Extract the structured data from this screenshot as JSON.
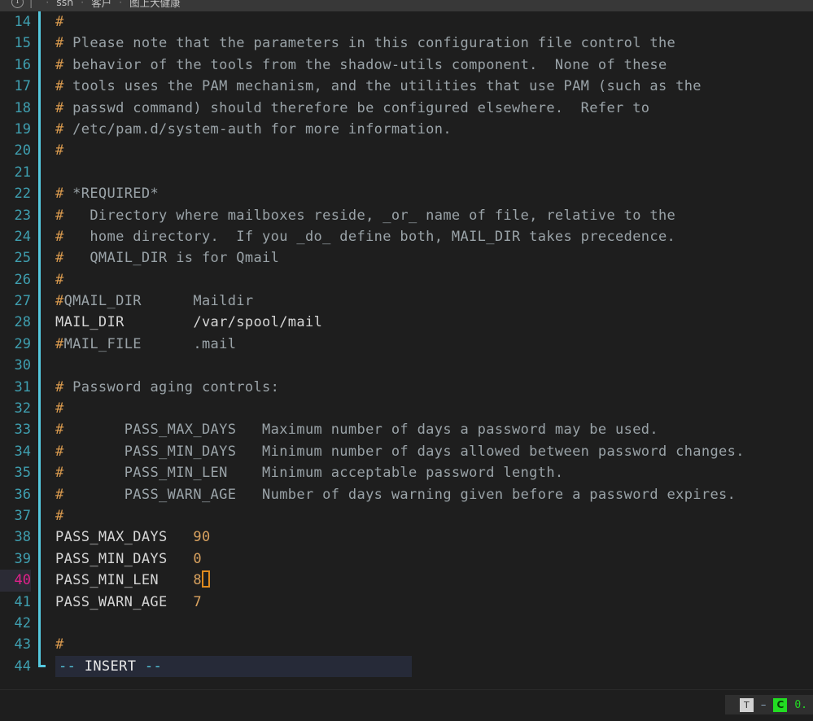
{
  "topbar": {
    "icon": "info-circle-icon",
    "icon_glyph": "i",
    "divider": "|",
    "crumbs": [
      "ssh",
      "客户",
      "图上大健康"
    ],
    "separator": "·"
  },
  "editor": {
    "mode_line": "-- INSERT --",
    "cursor_line": 40,
    "cursor_col_text": "8",
    "lines": [
      {
        "n": 14,
        "guide": "bar",
        "text": "#"
      },
      {
        "n": 15,
        "guide": "bar",
        "text": "# Please note that the parameters in this configuration file control the"
      },
      {
        "n": 16,
        "guide": "bar",
        "text": "# behavior of the tools from the shadow-utils component.  None of these"
      },
      {
        "n": 17,
        "guide": "bar",
        "text": "# tools uses the PAM mechanism, and the utilities that use PAM (such as the"
      },
      {
        "n": 18,
        "guide": "bar",
        "text": "# passwd command) should therefore be configured elsewhere.  Refer to"
      },
      {
        "n": 19,
        "guide": "bar",
        "text": "# /etc/pam.d/system-auth for more information."
      },
      {
        "n": 20,
        "guide": "bar",
        "text": "#"
      },
      {
        "n": 21,
        "guide": "bar",
        "text": ""
      },
      {
        "n": 22,
        "guide": "bar",
        "text": "# *REQUIRED*"
      },
      {
        "n": 23,
        "guide": "bar",
        "text": "#   Directory where mailboxes reside, _or_ name of file, relative to the"
      },
      {
        "n": 24,
        "guide": "bar",
        "text": "#   home directory.  If you _do_ define both, MAIL_DIR takes precedence."
      },
      {
        "n": 25,
        "guide": "bar",
        "text": "#   QMAIL_DIR is for Qmail"
      },
      {
        "n": 26,
        "guide": "bar",
        "text": "#"
      },
      {
        "n": 27,
        "guide": "bar",
        "text": "#QMAIL_DIR      Maildir"
      },
      {
        "n": 28,
        "guide": "bar",
        "text": "MAIL_DIR        /var/spool/mail"
      },
      {
        "n": 29,
        "guide": "bar",
        "text": "#MAIL_FILE      .mail"
      },
      {
        "n": 30,
        "guide": "bar",
        "text": ""
      },
      {
        "n": 31,
        "guide": "bar",
        "text": "# Password aging controls:"
      },
      {
        "n": 32,
        "guide": "bar",
        "text": "#"
      },
      {
        "n": 33,
        "guide": "bar",
        "text": "#       PASS_MAX_DAYS   Maximum number of days a password may be used."
      },
      {
        "n": 34,
        "guide": "bar",
        "text": "#       PASS_MIN_DAYS   Minimum number of days allowed between password changes."
      },
      {
        "n": 35,
        "guide": "bar",
        "text": "#       PASS_MIN_LEN    Minimum acceptable password length."
      },
      {
        "n": 36,
        "guide": "bar",
        "text": "#       PASS_WARN_AGE   Number of days warning given before a password expires."
      },
      {
        "n": 37,
        "guide": "bar",
        "text": "#"
      },
      {
        "n": 38,
        "guide": "bar",
        "text": "PASS_MAX_DAYS   90"
      },
      {
        "n": 39,
        "guide": "bar",
        "text": "PASS_MIN_DAYS   0"
      },
      {
        "n": 40,
        "guide": "bar",
        "text": "PASS_MIN_LEN    8",
        "cursor": true
      },
      {
        "n": 41,
        "guide": "bar",
        "text": "PASS_WARN_AGE   7"
      },
      {
        "n": 42,
        "guide": "bar",
        "text": ""
      },
      {
        "n": 43,
        "guide": "bar",
        "text": "#"
      },
      {
        "n": 44,
        "guide": "foot",
        "text": "-- INSERT --",
        "is_mode": true
      }
    ]
  },
  "ime": {
    "key_label": "T",
    "dash": "–",
    "lang_label": "C",
    "version": "0."
  },
  "colors": {
    "editor_bg": "#1e1e1e",
    "gutter_fg": "#3f9fb0",
    "cursor_line_fg": "#e0218a",
    "guide": "#55c8de",
    "comment": "#9aa3a8",
    "hash": "#d99a4e",
    "number": "#d9a25f",
    "cursor_border": "#e08a1e",
    "insert_bg": "#262a38",
    "ime_green": "#22dd22"
  }
}
